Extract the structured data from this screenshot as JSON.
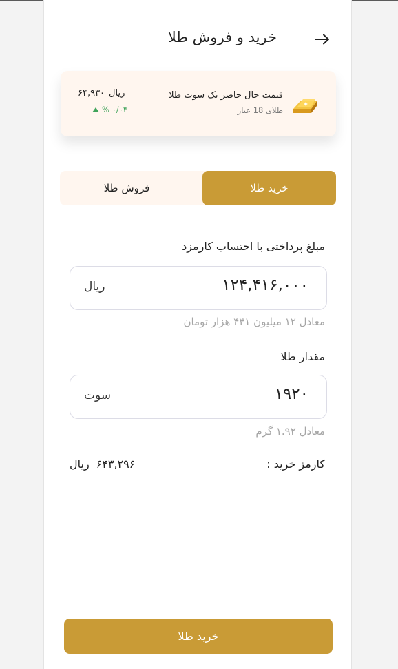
{
  "header": {
    "title": "خرید و فروش طلا",
    "back_icon": "arrow-right-icon"
  },
  "price_card": {
    "icon": "gold-bar-icon",
    "label": "قیمت حال حاضر یک سوت طلا",
    "karat": "طلای 18 عیار",
    "value": "۶۴,۹۳۰",
    "currency": "ریال",
    "change": "% ۰/۰۴",
    "change_direction": "up",
    "change_color": "#3fa35a"
  },
  "tabs": {
    "buy": "خرید طلا",
    "sell": "فروش طلا",
    "active": "buy"
  },
  "payment": {
    "label": "مبلغ پرداختی با احتساب کارمزد",
    "value": "۱۲۴,۴۱۶,۰۰۰",
    "unit": "ریال",
    "hint": "معادل ۱۲ میلیون ۴۴۱ هزار تومان"
  },
  "amount": {
    "label": "مقدار طلا",
    "value": "۱۹۲۰",
    "unit": "سوت",
    "hint": "معادل ۱.۹۲ گرم"
  },
  "fee": {
    "label": "کارمز خرید :",
    "value": "۶۴۳,۲۹۶",
    "currency": "ریال"
  },
  "submit": {
    "label": "خرید طلا"
  },
  "colors": {
    "accent": "#c99b36",
    "card_bg": "#fff6ef"
  }
}
